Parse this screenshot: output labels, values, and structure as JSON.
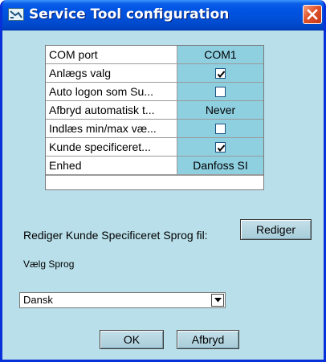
{
  "window": {
    "title": "Service Tool configuration",
    "icons": {
      "app": "service-tool-icon",
      "close": "close-icon"
    }
  },
  "settings": {
    "rows": [
      {
        "label": "COM port",
        "type": "text",
        "value": "COM1"
      },
      {
        "label": "Anlægs valg",
        "type": "checkbox",
        "checked": true
      },
      {
        "label": "Auto logon som Su...",
        "type": "checkbox",
        "checked": false
      },
      {
        "label": "Afbryd automatisk t...",
        "type": "text",
        "value": "Never"
      },
      {
        "label": "Indlæs min/max væ...",
        "type": "checkbox",
        "checked": false
      },
      {
        "label": "Kunde specificeret...",
        "type": "checkbox",
        "checked": true
      },
      {
        "label": "Enhed",
        "type": "text",
        "value": "Danfoss SI"
      }
    ]
  },
  "edit_language": {
    "label": "Rediger Kunde Specificeret Sprog fil:",
    "button": "Rediger"
  },
  "language": {
    "label": "Vælg Sprog",
    "selected": "Dansk"
  },
  "footer": {
    "ok": "OK",
    "cancel": "Afbryd"
  },
  "colors": {
    "titlebar": "#0054e3",
    "window_bg": "#b9e0ea",
    "value_cell": "#8ecfe0",
    "close_button": "#e0522a"
  }
}
